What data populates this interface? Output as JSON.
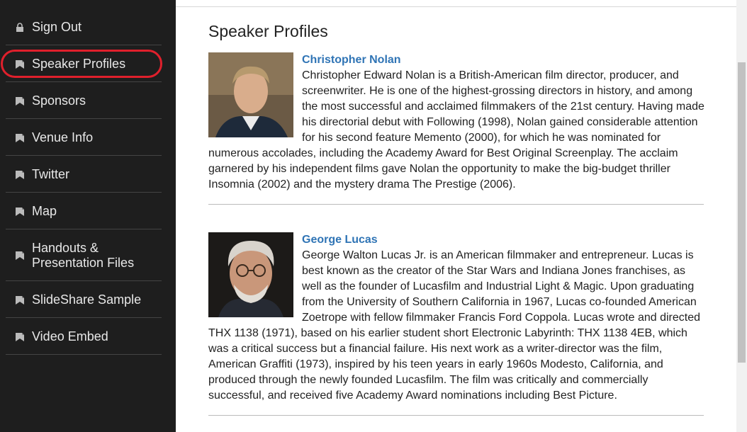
{
  "nav": [
    {
      "label": "Sign Out",
      "icon": "lock-icon"
    },
    {
      "label": "Speaker Profiles",
      "icon": "bookmark-icon"
    },
    {
      "label": "Sponsors",
      "icon": "bookmark-icon"
    },
    {
      "label": "Venue Info",
      "icon": "bookmark-icon"
    },
    {
      "label": "Twitter",
      "icon": "bookmark-icon"
    },
    {
      "label": "Map",
      "icon": "bookmark-icon"
    },
    {
      "label": "Handouts &",
      "label2": "Presentation Files",
      "icon": "bookmark-icon"
    },
    {
      "label": "SlideShare Sample",
      "icon": "bookmark-icon"
    },
    {
      "label": "Video Embed",
      "icon": "bookmark-icon"
    }
  ],
  "page_title": "Speaker Profiles",
  "profiles": [
    {
      "name": "Christopher Nolan",
      "bio": "Christopher Edward Nolan is a British-American film director, producer, and screenwriter. He is one of the highest-grossing directors in history, and among the most successful and acclaimed filmmakers of the 21st century. Having made his directorial debut with Following (1998), Nolan gained considerable attention for his second feature Memento (2000), for which he was nominated for numerous accolades, including the Academy Award for Best Original Screenplay. The acclaim garnered by his independent films gave Nolan the opportunity to make the big-budget thriller Insomnia (2002) and the mystery drama The Prestige (2006)."
    },
    {
      "name": "George Lucas",
      "bio": "George Walton Lucas Jr. is an American filmmaker and entrepreneur. Lucas is best known as the creator of the Star Wars and Indiana Jones franchises, as well as the founder of Lucasfilm and Industrial Light & Magic. Upon graduating from the University of Southern California in 1967, Lucas co-founded American Zoetrope with fellow filmmaker Francis Ford Coppola. Lucas wrote and directed THX 1138 (1971), based on his earlier student short Electronic Labyrinth: THX 1138 4EB, which was a critical success but a financial failure. His next work as a writer-director was the film, American Graffiti (1973), inspired by his teen years in early 1960s Modesto, California, and produced through the newly founded Lucasfilm. The film was critically and commercially successful, and received five Academy Award nominations including Best Picture."
    }
  ],
  "colors": {
    "sidebar": "#1e1e1e",
    "link": "#2f74b5",
    "highlight": "#e0202c"
  }
}
